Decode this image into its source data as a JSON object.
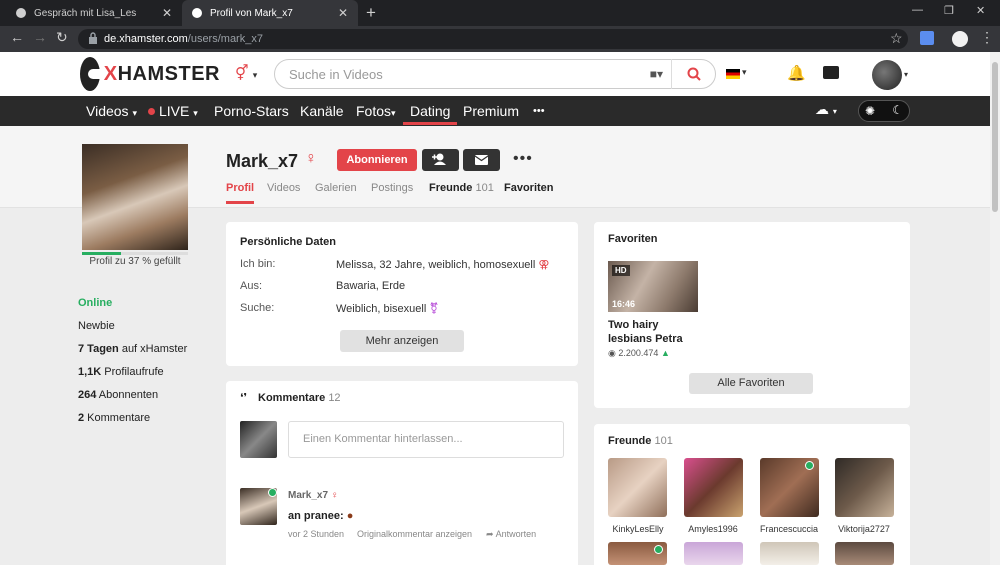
{
  "browser": {
    "tabs": [
      {
        "title": "Gespräch mit Lisa_Les",
        "active": false
      },
      {
        "title": "Profil von Mark_x7",
        "active": true
      }
    ],
    "url_host": "de.xhamster.com",
    "url_path": "/users/mark_x7"
  },
  "header": {
    "logo_x": "X",
    "logo_rest": "HAMSTER",
    "search_placeholder": "Suche in Videos"
  },
  "nav": {
    "items": [
      "Videos",
      "LIVE",
      "Porno-Stars",
      "Kanäle",
      "Fotos",
      "Dating",
      "Premium"
    ],
    "more": "•••"
  },
  "profile": {
    "username": "Mark_x7",
    "gender_symbol": "♀",
    "subscribe_label": "Abonnieren",
    "completion_text": "Profil zu 37 % gefüllt",
    "completion": 0.37,
    "tabs": [
      {
        "label": "Profil",
        "count": ""
      },
      {
        "label": "Videos",
        "count": ""
      },
      {
        "label": "Galerien",
        "count": ""
      },
      {
        "label": "Postings",
        "count": ""
      },
      {
        "label": "Freunde",
        "count": "101"
      },
      {
        "label": "Favoriten",
        "count": ""
      }
    ]
  },
  "sidebar": {
    "online": "Online",
    "newbie": "Newbie",
    "days_bold": "7 Tagen",
    "days_rest": " auf xHamster",
    "views_bold": "1,1K",
    "views_rest": " Profilaufrufe",
    "subs_bold": "264",
    "subs_rest": " Abonnenten",
    "comments_bold": "2",
    "comments_rest": " Kommentare"
  },
  "personal": {
    "title": "Persönliche Daten",
    "rows": [
      {
        "label": "Ich bin:",
        "value": "Melissa, 32 Jahre, weiblich, homosexuell"
      },
      {
        "label": "Aus:",
        "value": "Bawaria, Erde"
      },
      {
        "label": "Suche:",
        "value": "Weiblich, bisexuell"
      }
    ],
    "more_button": "Mehr anzeigen"
  },
  "comments": {
    "title": "Kommentare",
    "count": "12",
    "input_placeholder": "Einen Kommentar hinterlassen...",
    "item": {
      "author": "Mark_x7",
      "text": "an pranee:",
      "time": "vor 2 Stunden",
      "original": "Originalkommentar anzeigen",
      "reply": "Antworten"
    }
  },
  "favorites": {
    "title": "Favoriten",
    "video": {
      "badge": "HD",
      "duration": "16:46",
      "title_line1": "Two hairy",
      "title_line2": "lesbians Petra",
      "views": "2.200.474"
    },
    "all_button": "Alle Favoriten"
  },
  "friends": {
    "title": "Freunde",
    "count": "101",
    "list": [
      {
        "name": "KinkyLesElly",
        "online": false
      },
      {
        "name": "Amyles1996",
        "online": false
      },
      {
        "name": "Francescuccia",
        "online": true
      },
      {
        "name": "Viktorija2727",
        "online": false
      }
    ]
  }
}
